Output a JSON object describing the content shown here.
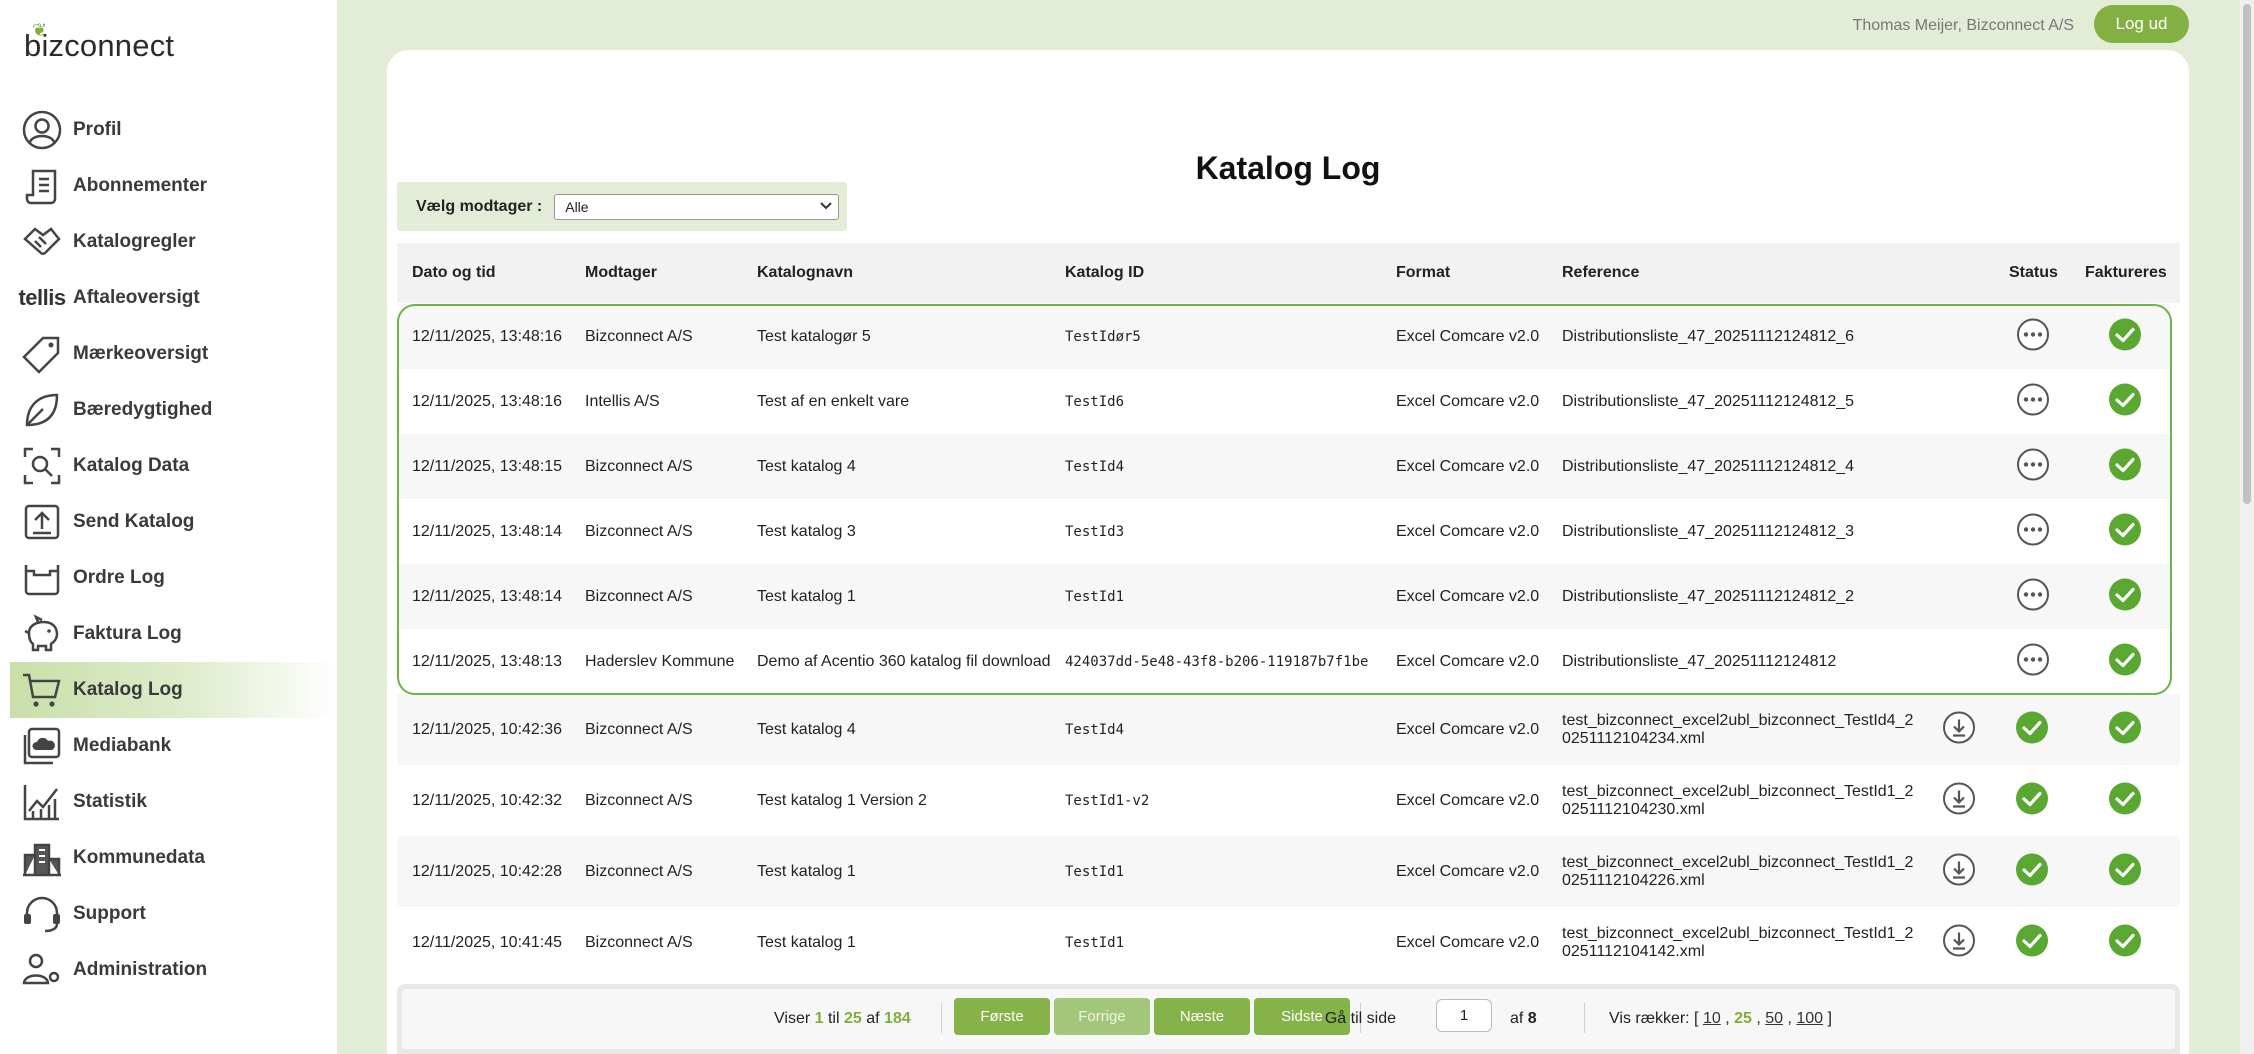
{
  "app": {
    "logo_text": "bizconnect"
  },
  "sidebar": {
    "items": [
      {
        "label": "Profil",
        "icon": "user-circle-icon"
      },
      {
        "label": "Abonnementer",
        "icon": "scroll-icon"
      },
      {
        "label": "Katalogregler",
        "icon": "handshake-icon"
      },
      {
        "label": "Aftaleoversigt",
        "icon": "tellis-logo",
        "icon_text": "tellis"
      },
      {
        "label": "Mærkeoversigt",
        "icon": "tag-icon"
      },
      {
        "label": "Bæredygtighed",
        "icon": "leaf-icon"
      },
      {
        "label": "Katalog Data",
        "icon": "search-frame-icon"
      },
      {
        "label": "Send Katalog",
        "icon": "upload-icon"
      },
      {
        "label": "Ordre Log",
        "icon": "basket-icon"
      },
      {
        "label": "Faktura Log",
        "icon": "piggy-bank-icon"
      },
      {
        "label": "Katalog Log",
        "icon": "cart-icon",
        "active": true
      },
      {
        "label": "Mediabank",
        "icon": "image-cloud-icon"
      },
      {
        "label": "Statistik",
        "icon": "chart-icon"
      },
      {
        "label": "Kommunedata",
        "icon": "buildings-icon"
      },
      {
        "label": "Support",
        "icon": "headset-icon"
      },
      {
        "label": "Administration",
        "icon": "users-gear-icon"
      }
    ]
  },
  "header": {
    "user": "Thomas Meijer, Bizconnect A/S",
    "logout_label": "Log ud"
  },
  "page": {
    "title": "Katalog Log",
    "filter_label": "Vælg modtager :",
    "filter_value": "Alle"
  },
  "table": {
    "headers": {
      "date": "Dato og tid",
      "recipient": "Modtager",
      "catalog_name": "Katalognavn",
      "catalog_id": "Katalog ID",
      "format": "Format",
      "reference": "Reference",
      "status": "Status",
      "invoiced": "Faktureres"
    },
    "rows": [
      {
        "date": "12/11/2025, 13:48:16",
        "recipient": "Bizconnect A/S",
        "catalog_name": "Test katalogør 5",
        "catalog_id": "TestIdør5",
        "format": "Excel Comcare v2.0",
        "reference": "Distributionsliste_47_20251112124812_6",
        "status": "pending",
        "invoiced": true,
        "download": false
      },
      {
        "date": "12/11/2025, 13:48:16",
        "recipient": "Intellis A/S",
        "catalog_name": "Test af en enkelt vare",
        "catalog_id": "TestId6",
        "format": "Excel Comcare v2.0",
        "reference": "Distributionsliste_47_20251112124812_5",
        "status": "pending",
        "invoiced": true,
        "download": false
      },
      {
        "date": "12/11/2025, 13:48:15",
        "recipient": "Bizconnect A/S",
        "catalog_name": "Test katalog 4",
        "catalog_id": "TestId4",
        "format": "Excel Comcare v2.0",
        "reference": "Distributionsliste_47_20251112124812_4",
        "status": "pending",
        "invoiced": true,
        "download": false
      },
      {
        "date": "12/11/2025, 13:48:14",
        "recipient": "Bizconnect A/S",
        "catalog_name": "Test katalog 3",
        "catalog_id": "TestId3",
        "format": "Excel Comcare v2.0",
        "reference": "Distributionsliste_47_20251112124812_3",
        "status": "pending",
        "invoiced": true,
        "download": false
      },
      {
        "date": "12/11/2025, 13:48:14",
        "recipient": "Bizconnect A/S",
        "catalog_name": "Test katalog 1",
        "catalog_id": "TestId1",
        "format": "Excel Comcare v2.0",
        "reference": "Distributionsliste_47_20251112124812_2",
        "status": "pending",
        "invoiced": true,
        "download": false
      },
      {
        "date": "12/11/2025, 13:48:13",
        "recipient": "Haderslev Kommune",
        "catalog_name": "Demo af Acentio 360 katalog fil download",
        "catalog_id": "424037dd-5e48-43f8-b206-119187b7f1be",
        "format": "Excel Comcare v2.0",
        "reference": "Distributionsliste_47_20251112124812",
        "status": "pending",
        "invoiced": true,
        "download": false
      },
      {
        "date": "12/11/2025, 10:42:36",
        "recipient": "Bizconnect A/S",
        "catalog_name": "Test katalog 4",
        "catalog_id": "TestId4",
        "format": "Excel Comcare v2.0",
        "reference": "test_bizconnect_excel2ubl_bizconnect_TestId4_2",
        "reference2": "0251112104234.xml",
        "status": "ok",
        "invoiced": true,
        "download": true
      },
      {
        "date": "12/11/2025, 10:42:32",
        "recipient": "Bizconnect A/S",
        "catalog_name": "Test katalog 1 Version 2",
        "catalog_id": "TestId1-v2",
        "format": "Excel Comcare v2.0",
        "reference": "test_bizconnect_excel2ubl_bizconnect_TestId1_2",
        "reference2": "0251112104230.xml",
        "status": "ok",
        "invoiced": true,
        "download": true
      },
      {
        "date": "12/11/2025, 10:42:28",
        "recipient": "Bizconnect A/S",
        "catalog_name": "Test katalog 1",
        "catalog_id": "TestId1",
        "format": "Excel Comcare v2.0",
        "reference": "test_bizconnect_excel2ubl_bizconnect_TestId1_2",
        "reference2": "0251112104226.xml",
        "status": "ok",
        "invoiced": true,
        "download": true
      },
      {
        "date": "12/11/2025, 10:41:45",
        "recipient": "Bizconnect A/S",
        "catalog_name": "Test katalog 1",
        "catalog_id": "TestId1",
        "format": "Excel Comcare v2.0",
        "reference": "test_bizconnect_excel2ubl_bizconnect_TestId1_2",
        "reference2": "0251112104142.xml",
        "status": "ok",
        "invoiced": true,
        "download": true
      }
    ]
  },
  "pager": {
    "showing_prefix": "Viser",
    "from": "1",
    "to_word": "til",
    "to": "25",
    "of_word": "af",
    "total": "184",
    "first": "Første",
    "prev": "Forrige",
    "next": "Næste",
    "last": "Sidste",
    "goto_label": "Gå til side",
    "current_page": "1",
    "of_pages_word": "af",
    "pages": "8",
    "rows_label": "Vis rækker: [",
    "rows_options": [
      "10",
      "25",
      "50",
      "100"
    ],
    "rows_selected": "25",
    "rows_close": "]"
  },
  "colors": {
    "accent": "#83b043",
    "background": "#e3ecd6",
    "group_border": "#6fb34a"
  }
}
